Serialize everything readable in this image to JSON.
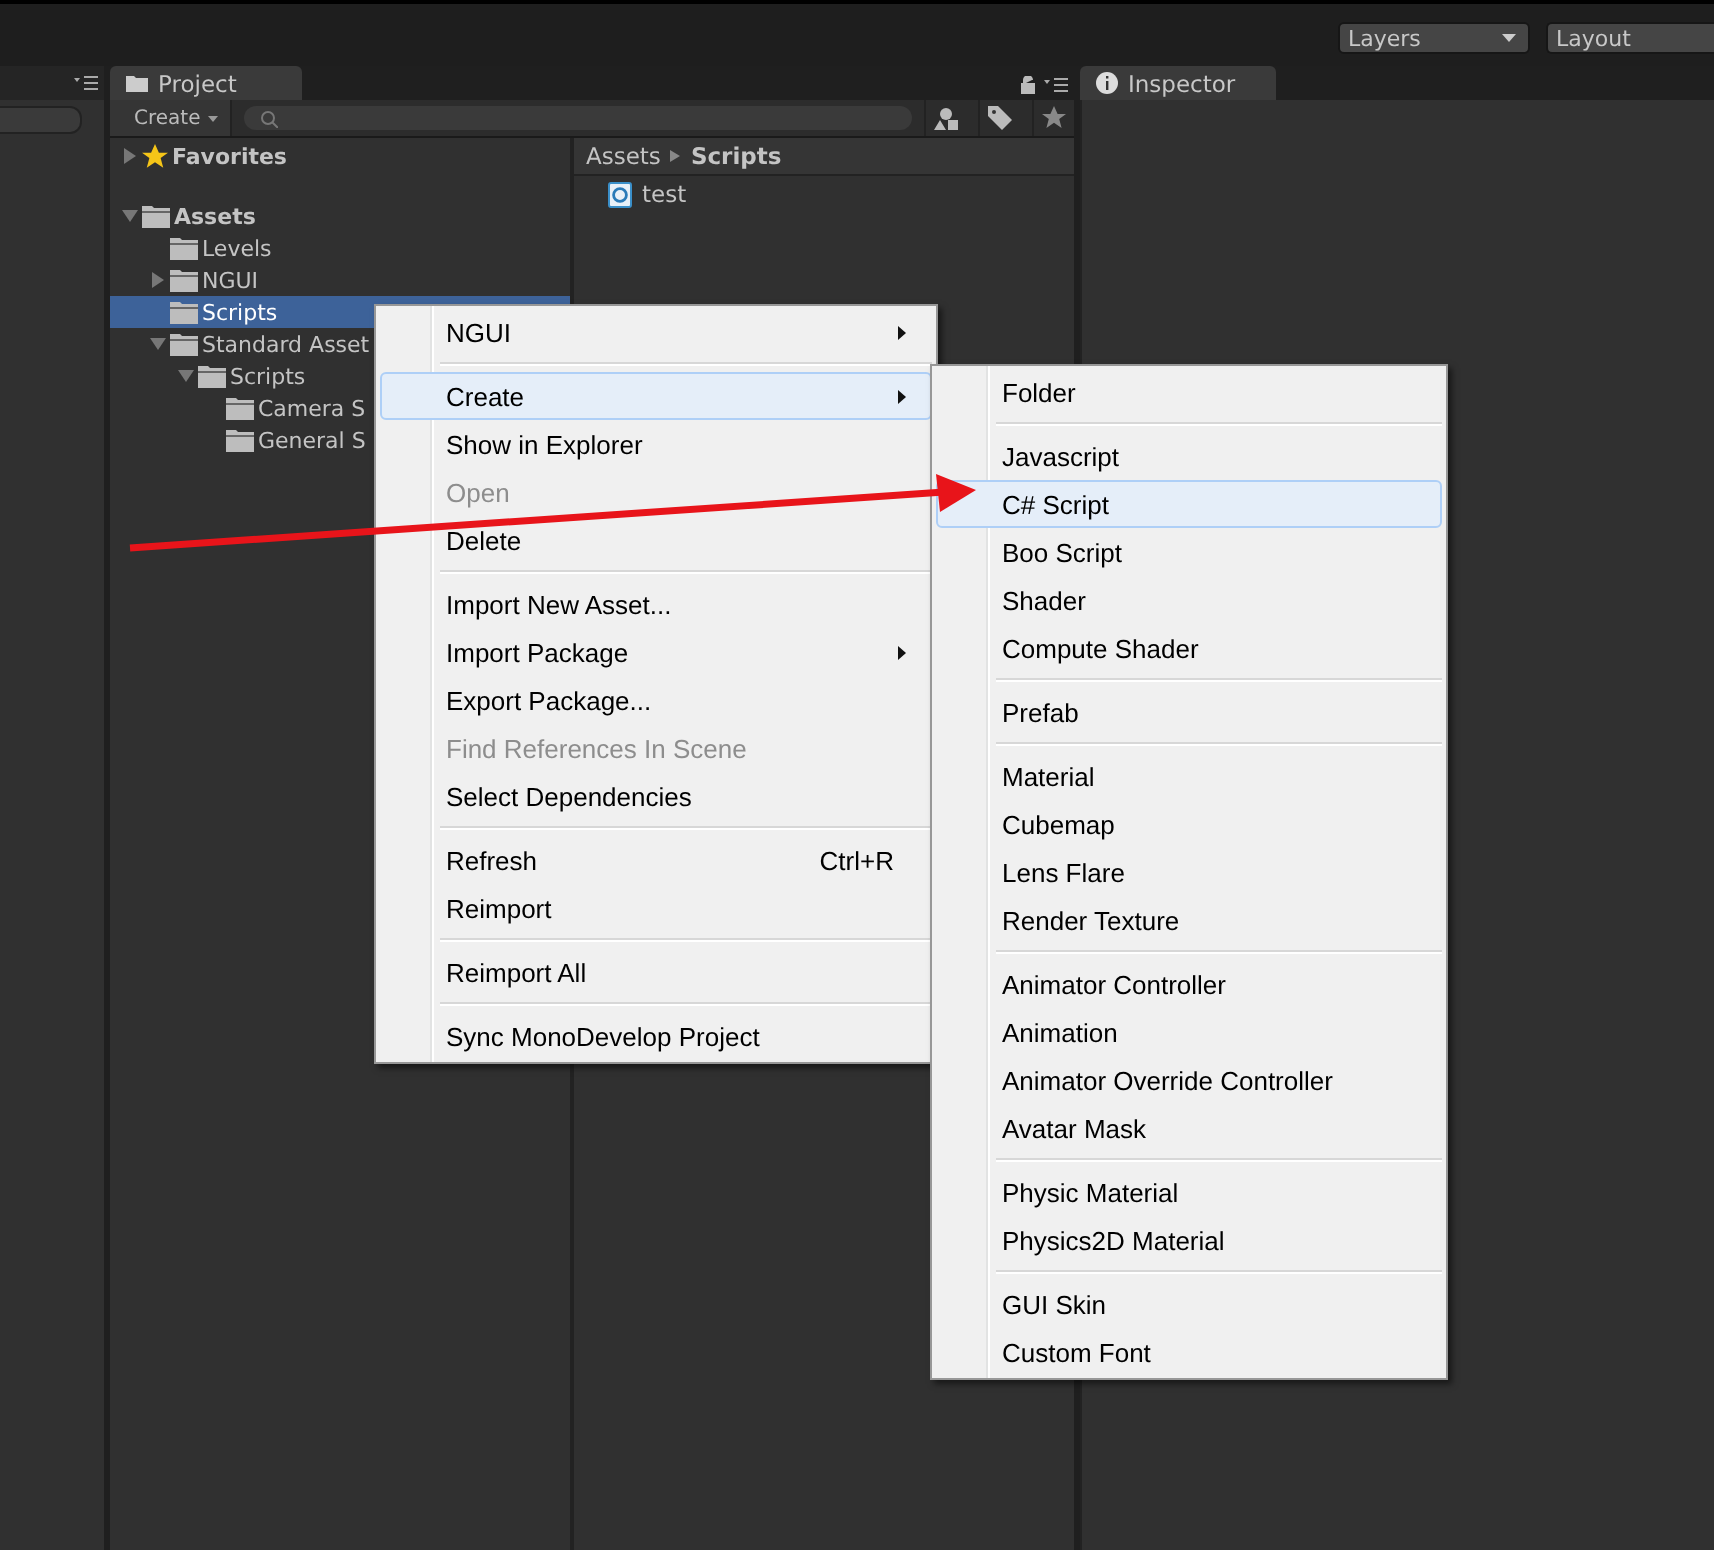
{
  "top_bar": {
    "dropdowns": [
      "Layers",
      "Layout"
    ]
  },
  "project": {
    "tab": "Project",
    "create_button": "Create",
    "breadcrumb": [
      "Assets",
      "Scripts"
    ],
    "tree": [
      {
        "label": "Favorites",
        "kind": "favorites",
        "expandable": true,
        "expanded": false,
        "selected": false
      },
      {
        "label": "Assets",
        "kind": "root",
        "expandable": true,
        "expanded": true,
        "selected": false,
        "children": [
          {
            "label": "Levels",
            "kind": "folder",
            "expandable": false,
            "selected": false
          },
          {
            "label": "NGUI",
            "kind": "folder",
            "expandable": true,
            "expanded": false,
            "selected": false
          },
          {
            "label": "Scripts",
            "kind": "folder",
            "expandable": false,
            "selected": true
          },
          {
            "label": "Standard Asset",
            "kind": "folder",
            "expandable": true,
            "expanded": true,
            "selected": false,
            "children": [
              {
                "label": "Scripts",
                "kind": "folder",
                "expandable": true,
                "expanded": true,
                "selected": false,
                "children": [
                  {
                    "label": "Camera S",
                    "kind": "folder",
                    "expandable": false,
                    "selected": false
                  },
                  {
                    "label": "General S",
                    "kind": "folder",
                    "expandable": false,
                    "selected": false
                  }
                ]
              }
            ]
          }
        ]
      }
    ],
    "files": [
      {
        "name": "test"
      }
    ]
  },
  "inspector": {
    "tab": "Inspector"
  },
  "context_menu": {
    "groups": [
      [
        {
          "label": "NGUI",
          "submenu": true,
          "disabled": false,
          "selected": false
        }
      ],
      [
        {
          "label": "Create",
          "submenu": true,
          "disabled": false,
          "selected": true
        },
        {
          "label": "Show in Explorer",
          "submenu": false,
          "disabled": false,
          "selected": false
        },
        {
          "label": "Open",
          "submenu": false,
          "disabled": true,
          "selected": false
        },
        {
          "label": "Delete",
          "submenu": false,
          "disabled": false,
          "selected": false
        }
      ],
      [
        {
          "label": "Import New Asset...",
          "submenu": false,
          "disabled": false,
          "selected": false
        },
        {
          "label": "Import Package",
          "submenu": true,
          "disabled": false,
          "selected": false
        },
        {
          "label": "Export Package...",
          "submenu": false,
          "disabled": false,
          "selected": false
        },
        {
          "label": "Find References In Scene",
          "submenu": false,
          "disabled": true,
          "selected": false
        },
        {
          "label": "Select Dependencies",
          "submenu": false,
          "disabled": false,
          "selected": false
        }
      ],
      [
        {
          "label": "Refresh",
          "shortcut": "Ctrl+R",
          "submenu": false,
          "disabled": false,
          "selected": false
        },
        {
          "label": "Reimport",
          "submenu": false,
          "disabled": false,
          "selected": false
        }
      ],
      [
        {
          "label": "Reimport All",
          "submenu": false,
          "disabled": false,
          "selected": false
        }
      ],
      [
        {
          "label": "Sync MonoDevelop Project",
          "submenu": false,
          "disabled": false,
          "selected": false
        }
      ]
    ]
  },
  "create_submenu": {
    "groups": [
      [
        {
          "label": "Folder",
          "selected": false
        }
      ],
      [
        {
          "label": "Javascript",
          "selected": false
        },
        {
          "label": "C# Script",
          "selected": true
        },
        {
          "label": "Boo Script",
          "selected": false
        },
        {
          "label": "Shader",
          "selected": false
        },
        {
          "label": "Compute Shader",
          "selected": false
        }
      ],
      [
        {
          "label": "Prefab",
          "selected": false
        }
      ],
      [
        {
          "label": "Material",
          "selected": false
        },
        {
          "label": "Cubemap",
          "selected": false
        },
        {
          "label": "Lens Flare",
          "selected": false
        },
        {
          "label": "Render Texture",
          "selected": false
        }
      ],
      [
        {
          "label": "Animator Controller",
          "selected": false
        },
        {
          "label": "Animation",
          "selected": false
        },
        {
          "label": "Animator Override Controller",
          "selected": false
        },
        {
          "label": "Avatar Mask",
          "selected": false
        }
      ],
      [
        {
          "label": "Physic Material",
          "selected": false
        },
        {
          "label": "Physics2D Material",
          "selected": false
        }
      ],
      [
        {
          "label": "GUI Skin",
          "selected": false
        },
        {
          "label": "Custom Font",
          "selected": false
        }
      ]
    ]
  }
}
